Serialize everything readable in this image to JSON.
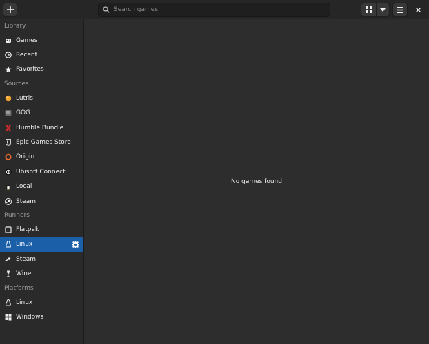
{
  "header": {
    "search_placeholder": "Search games"
  },
  "sidebar": {
    "sections": [
      {
        "title": "Library",
        "items": [
          "Games",
          "Recent",
          "Favorites"
        ]
      },
      {
        "title": "Sources",
        "items": [
          "Lutris",
          "GOG",
          "Humble Bundle",
          "Epic Games Store",
          "Origin",
          "Ubisoft Connect",
          "Local",
          "Steam"
        ]
      },
      {
        "title": "Runners",
        "items": [
          "Flatpak",
          "Linux",
          "Steam",
          "Wine"
        ],
        "selected": "Linux"
      },
      {
        "title": "Platforms",
        "items": [
          "Linux",
          "Windows"
        ]
      }
    ]
  },
  "main": {
    "empty_text": "No games found"
  },
  "colors": {
    "selected": "#1b5fa9",
    "humble": "#cc2a2a",
    "origin": "#f56c2d",
    "lutris": "#f0a030"
  }
}
